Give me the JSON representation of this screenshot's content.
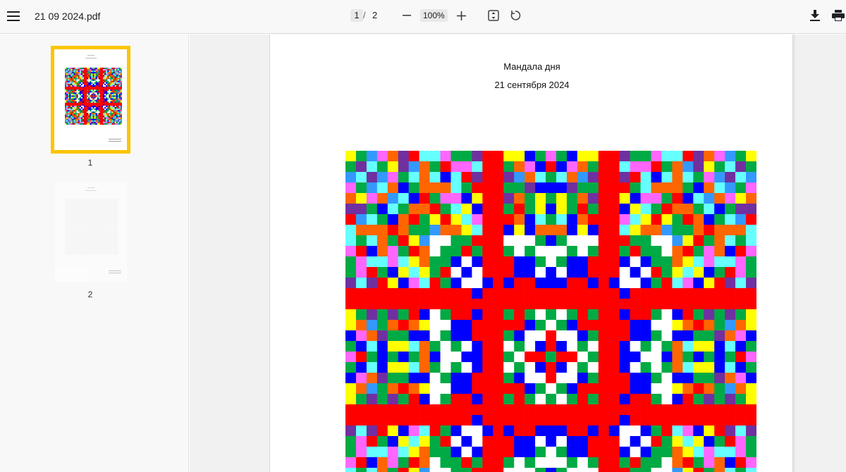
{
  "toolbar": {
    "menu_icon": "hamburger-menu-icon",
    "file_name": "21 09 2024.pdf",
    "current_page": "1",
    "page_separator": "/",
    "total_pages": "2",
    "zoom_out_icon": "minus-icon",
    "zoom_level": "100%",
    "zoom_in_icon": "plus-icon",
    "fit_icon": "fit-page-icon",
    "rotate_icon": "rotate-icon",
    "download_icon": "download-icon",
    "print_icon": "print-icon"
  },
  "sidebar": {
    "thumbnails": [
      {
        "label": "1",
        "selected": true
      },
      {
        "label": "2",
        "selected": false
      }
    ],
    "selected_color": "#fbc503"
  },
  "document": {
    "title": "Мандала дня",
    "date": "21 сентября 2024"
  },
  "colors": {
    "toolbar_bg": "#f8f8f8",
    "viewer_bg": "#f1f1f1",
    "mandala_palette": [
      "#ff0000",
      "#0000ff",
      "#ffff00",
      "#00aa44",
      "#ff66ff",
      "#66ffff",
      "#ff6600",
      "#7030a0",
      "#ffffff",
      "#3399ff"
    ]
  }
}
